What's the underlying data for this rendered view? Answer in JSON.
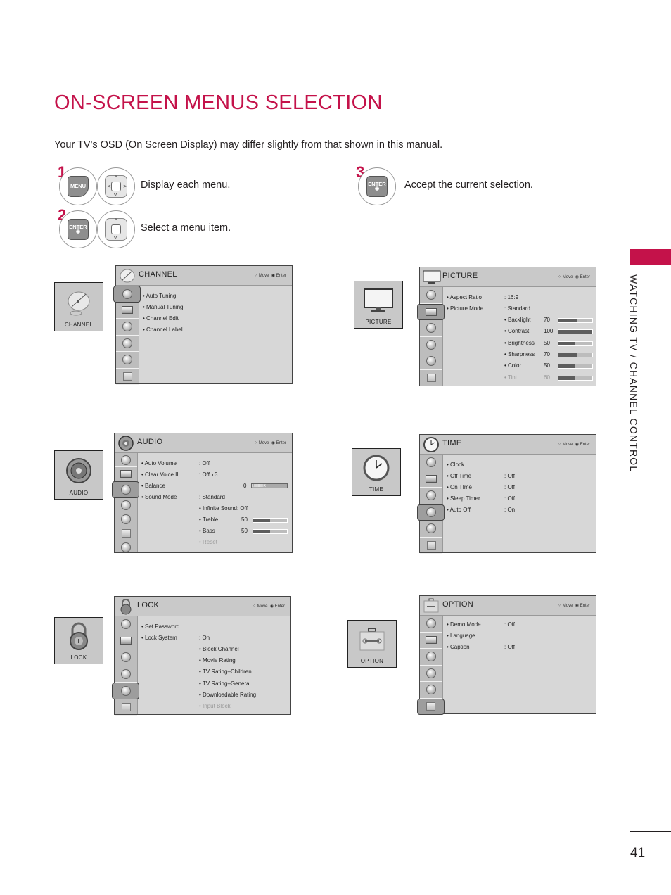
{
  "page": {
    "title": "ON-SCREEN MENUS SELECTION",
    "intro": "Your TV's OSD (On Screen Display) may differ slightly from that shown in this manual.",
    "section_tab": "WATCHING TV / CHANNEL CONTROL",
    "page_number": "41",
    "accent_color": "#c4124a"
  },
  "steps": [
    {
      "number": "1",
      "key": "MENU",
      "text": "Display each menu."
    },
    {
      "number": "2",
      "key": "ENTER",
      "text": "Select a menu item."
    },
    {
      "number": "3",
      "key": "ENTER",
      "text": "Accept the current selection."
    }
  ],
  "osd_common": {
    "move": "Move",
    "enter": "Enter"
  },
  "menus": {
    "channel": {
      "thumb_label": "CHANNEL",
      "title": "CHANNEL",
      "items": [
        "• Auto Tuning",
        "• Manual Tuning",
        "• Channel Edit",
        "• Channel Label"
      ]
    },
    "picture": {
      "thumb_label": "PICTURE",
      "title": "PICTURE",
      "items": [
        {
          "label": "• Aspect Ratio",
          "value": ": 16:9"
        },
        {
          "label": "• Picture Mode",
          "value": ": Standard"
        }
      ],
      "sub": [
        {
          "label": "• Backlight",
          "value": "70",
          "level": 0.56
        },
        {
          "label": "• Contrast",
          "value": "100",
          "level": 1.0
        },
        {
          "label": "• Brightness",
          "value": "50",
          "level": 0.48
        },
        {
          "label": "• Sharpness",
          "value": "70",
          "level": 0.56
        },
        {
          "label": "• Color",
          "value": "50",
          "level": 0.48
        },
        {
          "label": "• Tint",
          "value": "60",
          "level": 0.48
        }
      ]
    },
    "audio": {
      "thumb_label": "AUDIO",
      "title": "AUDIO",
      "items": [
        {
          "label": "• Auto Volume",
          "value": ": Off"
        },
        {
          "label": "• Clear Voice II",
          "value": ": Off ◐3"
        },
        {
          "label": "• Balance",
          "value": "0"
        },
        {
          "label": "• Sound Mode",
          "value": ": Standard"
        }
      ],
      "balance_scale": "L IIIIIIIIIIIIII R",
      "sub": [
        {
          "label": "• Infinite Sound: Off"
        },
        {
          "label": "• Treble",
          "value": "50",
          "level": 0.5
        },
        {
          "label": "• Bass",
          "value": "50",
          "level": 0.5
        },
        {
          "label": "• Reset"
        }
      ]
    },
    "time": {
      "thumb_label": "TIME",
      "title": "TIME",
      "items": [
        {
          "label": "• Clock",
          "value": ""
        },
        {
          "label": "• Off Time",
          "value": ": Off"
        },
        {
          "label": "• On TIme",
          "value": ": Off"
        },
        {
          "label": "• Sleep Timer",
          "value": ": Off"
        },
        {
          "label": "• Auto Off",
          "value": ": On"
        }
      ]
    },
    "lock": {
      "thumb_label": "LOCK",
      "title": "LOCK",
      "items": [
        {
          "label": "• Set Password",
          "value": ""
        },
        {
          "label": "• Lock System",
          "value": ": On"
        }
      ],
      "sub": [
        "• Block Channel",
        "• Movie Rating",
        "• TV Rating–Children",
        "• TV Rating–General",
        "• Downloadable Rating",
        "• Input Block"
      ]
    },
    "option": {
      "thumb_label": "OPTION",
      "title": "OPTION",
      "items": [
        {
          "label": "• Demo Mode",
          "value": ": Off"
        },
        {
          "label": "• Language",
          "value": ""
        },
        {
          "label": "• Caption",
          "value": ": Off"
        }
      ]
    }
  }
}
